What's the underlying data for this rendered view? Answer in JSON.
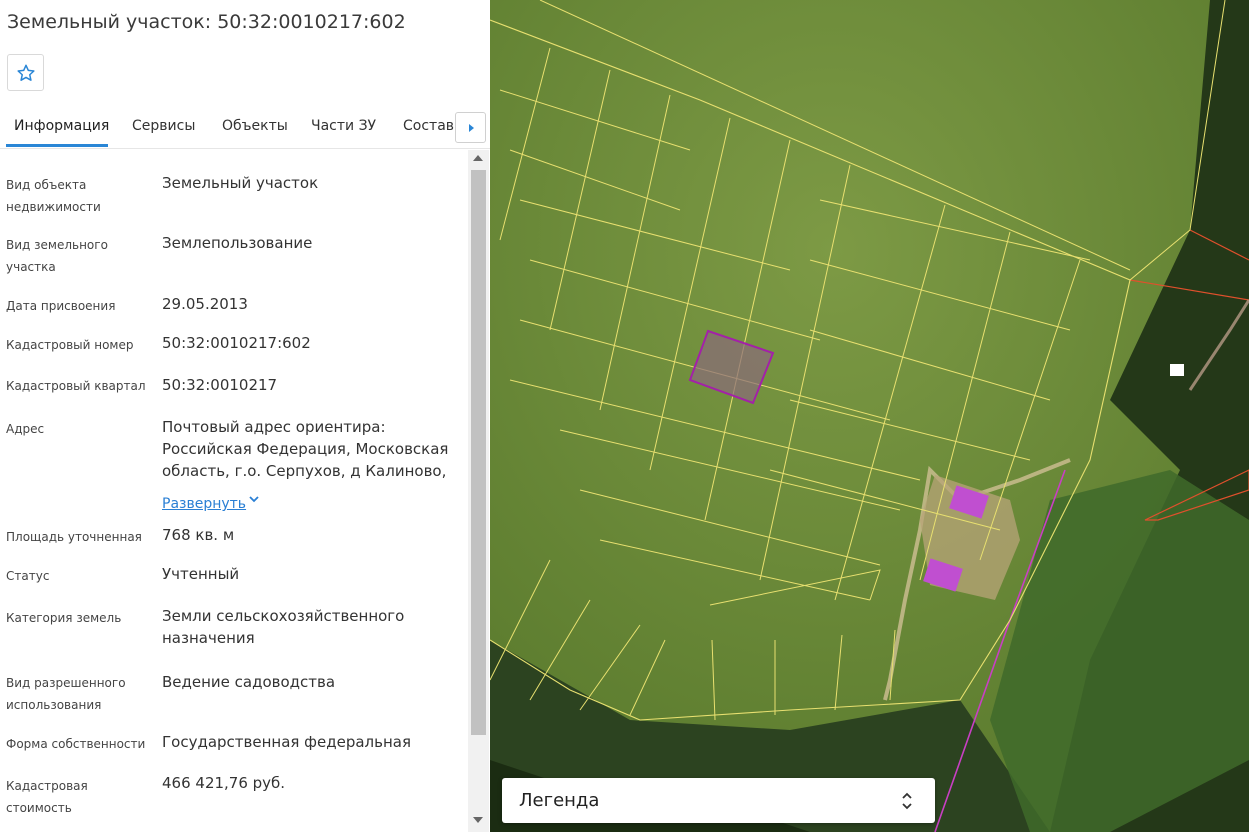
{
  "header": {
    "title": "Земельный участок: 50:32:0010217:602"
  },
  "tabs": [
    {
      "label": "Информация",
      "active": true
    },
    {
      "label": "Сервисы",
      "active": false
    },
    {
      "label": "Объекты",
      "active": false
    },
    {
      "label": "Части ЗУ",
      "active": false
    },
    {
      "label": "Состав",
      "active": false
    }
  ],
  "info": {
    "rows": [
      {
        "label": "Вид объекта недвижимости",
        "value": "Земельный участок"
      },
      {
        "label": "Вид земельного участка",
        "value": "Землепользование"
      },
      {
        "label": "Дата присвоения",
        "value": "29.05.2013"
      },
      {
        "label": "Кадастровый номер",
        "value": "50:32:0010217:602"
      },
      {
        "label": "Кадастровый квартал",
        "value": "50:32:0010217"
      },
      {
        "label": "Адрес",
        "value": "Почтовый адрес ориентира: Российская Федерация, Московская область, г.о. Серпухов, д Калиново,"
      },
      {
        "label": "Площадь уточненная",
        "value": "768 кв. м"
      },
      {
        "label": "Статус",
        "value": "Учтенный"
      },
      {
        "label": "Категория земель",
        "value": "Земли сельскохозяйственного назначения"
      },
      {
        "label": "Вид разрешенного использования",
        "value": "Ведение садоводства"
      },
      {
        "label": "Форма собственности",
        "value": "Государственная федеральная"
      },
      {
        "label": "Кадастровая стоимость",
        "value": "466 421,76 руб."
      }
    ],
    "expand_link": "Развернуть"
  },
  "map": {
    "legend_label": "Легенда"
  },
  "icons": {
    "favorite": "star-icon",
    "tabs_next": "caret-right-icon",
    "expand": "chevron-down-icon",
    "legend_toggle": "unfold-icon"
  },
  "colors": {
    "accent": "#2a86d6",
    "parcel_boundary": "#e8e070",
    "selected_parcel": "#a321a8",
    "building": "#c04fd0",
    "red_boundary": "#e0502c"
  }
}
